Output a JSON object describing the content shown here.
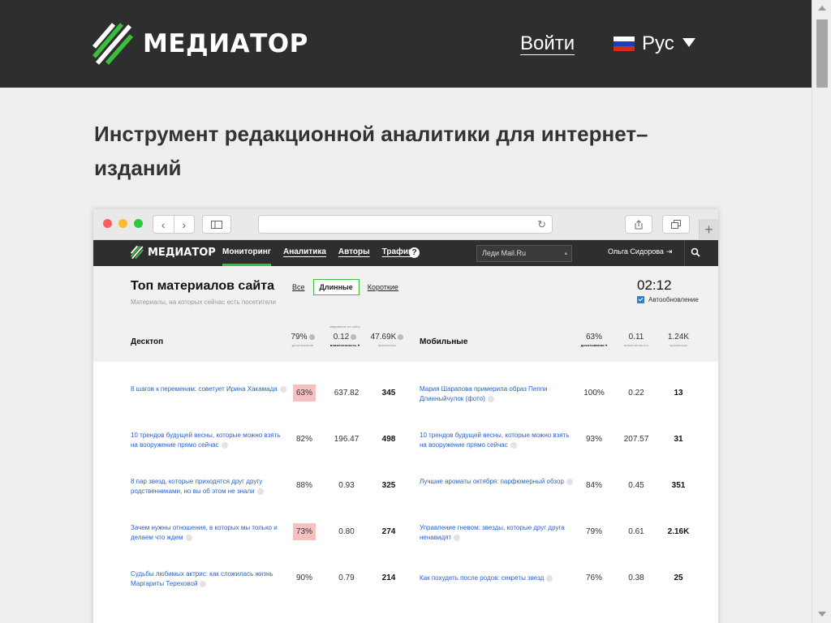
{
  "site": {
    "brand": "МЕДИАТОР",
    "login": "Войти",
    "language": "Рус",
    "hero": "Инструмент редакционной аналитики для интернет–изданий"
  },
  "colors": {
    "header_bg": "#2e2e2e",
    "accent_green": "#3bbf3b",
    "link_blue": "#2a63c7",
    "highlight_red": "#f7c0c0"
  },
  "icons": {
    "back": "chevron-left-icon",
    "forward": "chevron-right-icon",
    "sidebar": "sidebar-icon",
    "reload": "reload-icon",
    "share": "share-icon",
    "tabs": "tabs-icon",
    "help": "help-icon",
    "search": "search-icon",
    "logout": "logout-icon",
    "lang_caret": "caret-down-icon"
  },
  "app": {
    "brand": "МЕДИАТОР",
    "menu": [
      "Мониторинг",
      "Аналитика",
      "Авторы",
      "Трафик"
    ],
    "site_select": "Леди Mail.Ru",
    "user": "Ольга Сидорова",
    "page_title": "Топ материалов сайта",
    "filters": [
      "Все",
      "Длинные",
      "Короткие"
    ],
    "subtitle": "Материалы, на которых сейчас есть посетители",
    "clock": "02:12",
    "autoupdate": "Автообновление"
  },
  "desktop": {
    "label": "Десктоп",
    "metrics": [
      {
        "value": "79%",
        "label": "дочитывания",
        "top": ""
      },
      {
        "value": "0.12",
        "label": "вовлеченность ▾",
        "top": "медианное по сайту"
      },
      {
        "value": "47.69K",
        "label": "просмотры",
        "top": ""
      }
    ]
  },
  "mobile": {
    "label": "Мобильные",
    "metrics": [
      {
        "value": "63%",
        "label": "дочитывания ▾",
        "top": ""
      },
      {
        "value": "0.11",
        "label": "вовлеченность",
        "top": ""
      },
      {
        "value": "1.24K",
        "label": "просмотры",
        "top": ""
      }
    ]
  },
  "rows": [
    {
      "d_title": "8 шагов к переменам: советует Ирина Хакамада",
      "d_read": "63%",
      "d_eng": "637.82",
      "d_views": "345",
      "m_title": "Мария Шарапова примерила образ Пеппи Длинныйчулок (фото)",
      "m_read": "100%",
      "m_eng": "0.22",
      "m_views": "13"
    },
    {
      "d_title": "10 трендов будущей весны, которые можно взять на вооружение прямо сейчас",
      "d_read": "82%",
      "d_eng": "196.47",
      "d_views": "498",
      "m_title": "10 трендов будущей весны, которые можно взять на вооружение прямо сейчас",
      "m_read": "93%",
      "m_eng": "207.57",
      "m_views": "31"
    },
    {
      "d_title": "8 пар звезд, которые приходятся друг другу родственниками, но вы об этом не знали",
      "d_read": "88%",
      "d_eng": "0.93",
      "d_views": "325",
      "m_title": "Лучшие ароматы октября: парфюмерный обзор",
      "m_read": "84%",
      "m_eng": "0.45",
      "m_views": "351"
    },
    {
      "d_title": "Зачем нужны отношения, в которых мы только и делаем что ждем",
      "d_read": "73%",
      "d_eng": "0.80",
      "d_views": "274",
      "m_title": "Управление гневом: звезды, которые друг друга ненавидят",
      "m_read": "79%",
      "m_eng": "0.61",
      "m_views": "2.16K"
    },
    {
      "d_title": "Судьбы любимых актрис: как сложилась жизнь Маргариты Тереховой",
      "d_read": "90%",
      "d_eng": "0.79",
      "d_views": "214",
      "m_title": "Как похудеть после родов: секреты звезд",
      "m_read": "76%",
      "m_eng": "0.38",
      "m_views": "25"
    }
  ]
}
